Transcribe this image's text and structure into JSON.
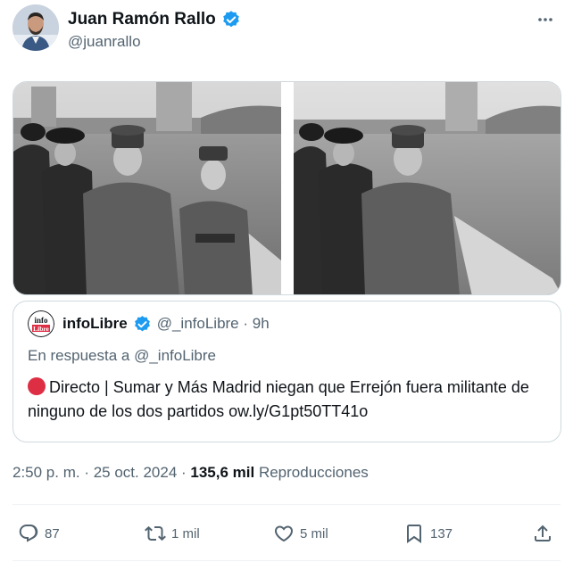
{
  "author": {
    "name": "Juan Ramón Rallo",
    "handle": "@juanrallo",
    "verified_icon": "verified-badge-icon",
    "more_icon": "more-horizontal-icon"
  },
  "quoted": {
    "logo_line1": "info",
    "logo_line2": "Libre",
    "name": "infoLibre",
    "handle_time": "@_infoLibre · 9h",
    "reply_to": "En respuesta a @_infoLibre",
    "text": "Directo | Sumar y Más Madrid niegan que Errejón fuera militante de ninguno de los dos partidos ow.ly/G1pt50TT41o",
    "bullet_color": "#dd2e44"
  },
  "meta": {
    "timestamp": "2:50 p. m. · 25 oct. 2024 · ",
    "views_count": "135,6 mil",
    "views_label": " Reproducciones"
  },
  "actions": {
    "replies": "87",
    "reposts": "1 mil",
    "likes": "5 mil",
    "bookmarks": "137"
  },
  "colors": {
    "text_primary": "#0f1419",
    "text_secondary": "#536471",
    "verified_blue": "#1d9bf0",
    "border": "#cfd9de"
  }
}
